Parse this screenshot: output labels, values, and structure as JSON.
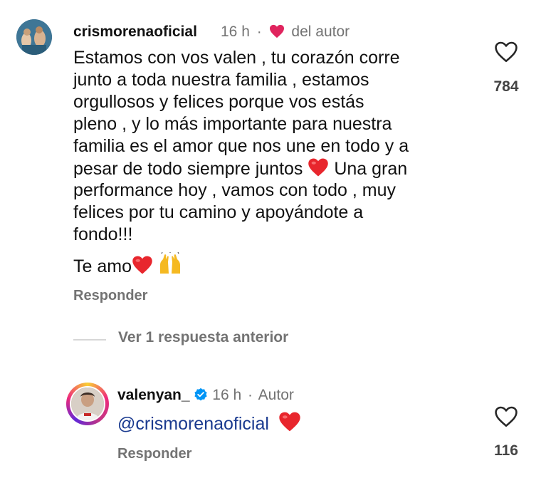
{
  "comment1": {
    "username": "crismorenaoficial",
    "time": "16 h",
    "separator": "·",
    "author_label": "del autor",
    "text_lines": [
      "Estamos con vos valen , tu corazón corre",
      "junto a toda nuestra familia , estamos",
      "orgullosos y felices porque vos estás",
      "pleno , y lo más importante para nuestra",
      "familia es el amor que nos une en todo y a",
      "pesar de todo siempre juntos",
      "Una gran",
      "performance hoy , vamos con todo , muy",
      "felices por tu camino y apoyándote a",
      "fondo!!!"
    ],
    "second_paragraph": "Te amo",
    "reply_label": "Responder",
    "like_count": "784"
  },
  "thread": {
    "view_replies_label": "Ver 1 respuesta anterior"
  },
  "comment2": {
    "username": "valenyan_",
    "time": "16 h",
    "separator": "·",
    "author_label": "Autor",
    "mention": "@crismorenaoficial",
    "reply_label": "Responder",
    "like_count": "116"
  },
  "icons": {
    "heart_like": "heart-outline-icon",
    "emoji_heart": "red-heart-emoji",
    "emoji_hands": "raising-hands-emoji",
    "verified": "verified-badge-icon"
  },
  "colors": {
    "heart_red": "#e0245e",
    "emoji_red": "#e8262d",
    "muted_gray": "#737373",
    "mention_blue": "#1a3a8f",
    "verified_blue": "#0095f6"
  }
}
